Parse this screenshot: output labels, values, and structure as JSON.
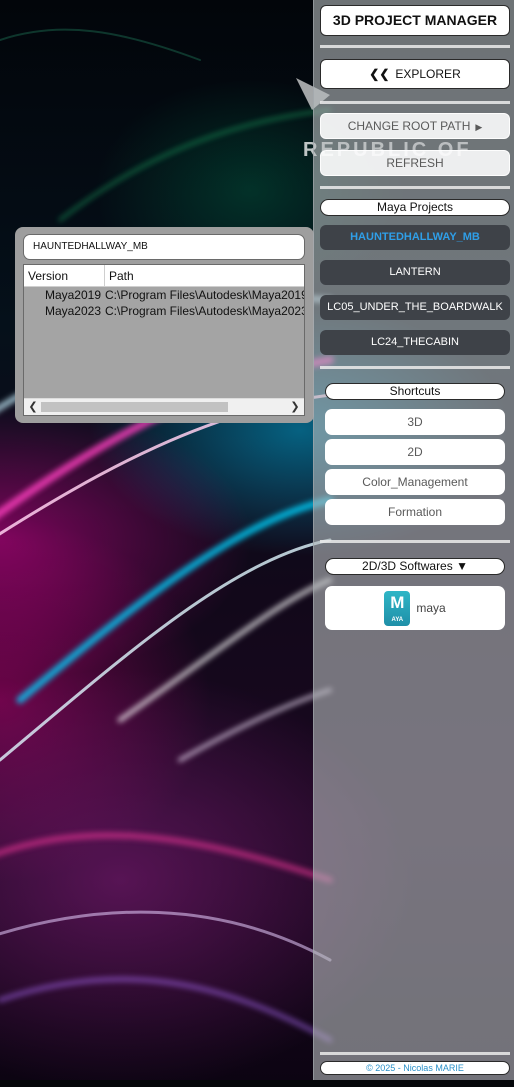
{
  "project_info": {
    "project_name": "HAUNTEDHALLWAY_MB",
    "table": {
      "headers": [
        "Version",
        "Path"
      ],
      "rows": [
        {
          "version": "Maya2019",
          "path": "C:\\Program Files\\Autodesk\\Maya2019"
        },
        {
          "version": "Maya2023",
          "path": "C:\\Program Files\\Autodesk\\Maya2023"
        }
      ]
    }
  },
  "panel": {
    "title": "3D PROJECT MANAGER",
    "explorer_label": "EXPLORER",
    "change_root_label": "CHANGE ROOT PATH",
    "refresh_label": "REFRESH",
    "maya_projects_label": "Maya Projects",
    "projects": [
      "HAUNTEDHALLWAY_MB",
      "LANTERN",
      "LC05_UNDER_THE_BOARDWALK",
      "LC24_THECABIN"
    ],
    "active_project": "HAUNTEDHALLWAY_MB",
    "shortcuts_label": "Shortcuts",
    "shortcuts": [
      "3D",
      "2D",
      "Color_Management",
      "Formation"
    ],
    "softwares_label": "2D/3D Softwares ▼",
    "softwares": [
      {
        "name": "maya",
        "icon": "maya-app-icon",
        "icon_letter": "M",
        "icon_sub": "AYA"
      }
    ],
    "footer": "© 2025 - Nicolas MARIE"
  },
  "colors": {
    "accent_active": "#2f9fe8",
    "project_button": "#3e4248",
    "footer_text": "#2a90c8",
    "maya_icon": "#2fb6c6"
  }
}
